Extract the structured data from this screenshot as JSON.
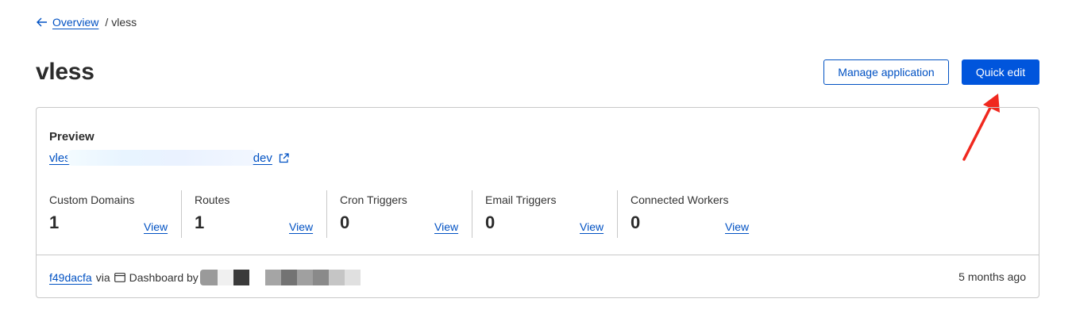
{
  "breadcrumb": {
    "back_label": "Overview",
    "current": "vless"
  },
  "page": {
    "title": "vless"
  },
  "actions": {
    "manage_label": "Manage application",
    "quick_edit_label": "Quick edit"
  },
  "preview": {
    "label": "Preview",
    "link_prefix": "vles",
    "link_suffix": "dev"
  },
  "stats": [
    {
      "label": "Custom Domains",
      "value": "1",
      "link": "View"
    },
    {
      "label": "Routes",
      "value": "1",
      "link": "View"
    },
    {
      "label": "Cron Triggers",
      "value": "0",
      "link": "View"
    },
    {
      "label": "Email Triggers",
      "value": "0",
      "link": "View"
    },
    {
      "label": "Connected Workers",
      "value": "0",
      "link": "View"
    }
  ],
  "deployment": {
    "commit": "f49dacfa",
    "via": "via",
    "source": "Dashboard by",
    "time": "5 months ago"
  },
  "colors": {
    "accent": "#0051c3",
    "primary_button": "#0055dc",
    "annotation_arrow": "#f0281e",
    "border": "#c8c8c8"
  }
}
